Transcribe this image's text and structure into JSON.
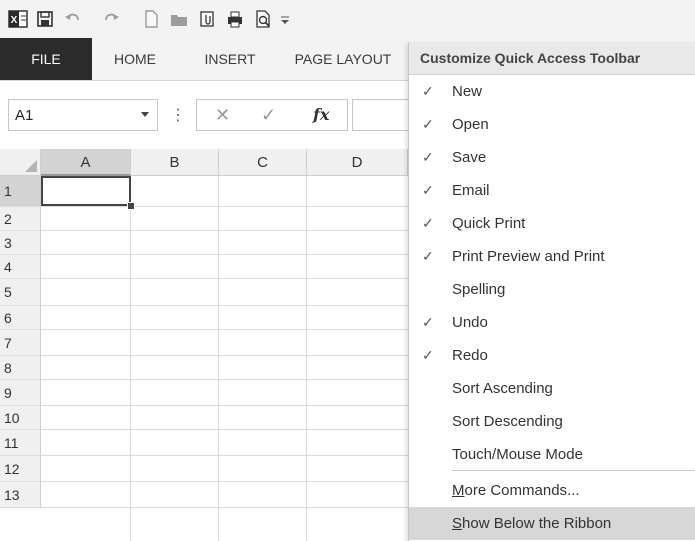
{
  "qat": {
    "icons": [
      "excel-logo-icon",
      "save-icon",
      "undo-icon",
      "redo-icon",
      "new-icon",
      "open-icon",
      "email-icon",
      "quick-print-icon",
      "print-preview-icon",
      "customize-qat-icon"
    ]
  },
  "ribbon": {
    "tabs": [
      "FILE",
      "HOME",
      "INSERT",
      "PAGE LAYOUT"
    ]
  },
  "formula_bar": {
    "name_box": "A1",
    "dots": "⋮",
    "cancel": "✕",
    "enter": "✓",
    "fx": "fx"
  },
  "sheet": {
    "columns": [
      "A",
      "B",
      "C",
      "D"
    ],
    "rows": [
      "1",
      "2",
      "3",
      "4",
      "5",
      "6",
      "7",
      "8",
      "9",
      "10",
      "11",
      "12",
      "13"
    ],
    "selected_cell": "A1"
  },
  "menu": {
    "title": "Customize Quick Access Toolbar",
    "items": [
      {
        "label": "New",
        "checked": true
      },
      {
        "label": "Open",
        "checked": true
      },
      {
        "label": "Save",
        "checked": true
      },
      {
        "label": "Email",
        "checked": true
      },
      {
        "label": "Quick Print",
        "checked": true
      },
      {
        "label": "Print Preview and Print",
        "checked": true
      },
      {
        "label": "Spelling",
        "checked": false
      },
      {
        "label": "Undo",
        "checked": true
      },
      {
        "label": "Redo",
        "checked": true
      },
      {
        "label": "Sort Ascending",
        "checked": false
      },
      {
        "label": "Sort Descending",
        "checked": false
      },
      {
        "label": "Touch/Mouse Mode",
        "checked": false
      }
    ],
    "more_commands": {
      "underline": "M",
      "rest": "ore Commands..."
    },
    "show_below": {
      "underline": "S",
      "rest": "how Below the Ribbon"
    },
    "check_glyph": "✓"
  }
}
